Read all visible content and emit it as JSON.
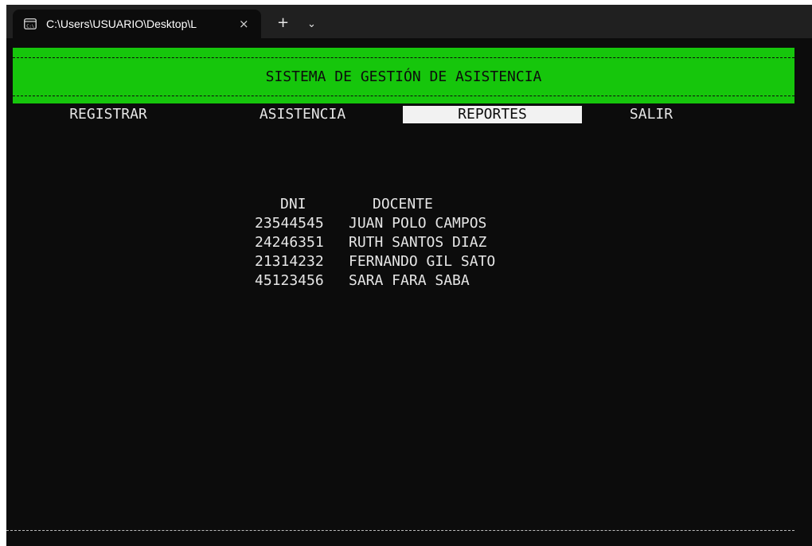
{
  "window": {
    "tab_title": "C:\\Users\\USUARIO\\Desktop\\L",
    "tab_icon": "terminal-icon",
    "close_glyph": "×",
    "new_tab_glyph": "+",
    "dropdown_glyph": "⌄"
  },
  "header": {
    "title": "SISTEMA DE GESTIÓN DE ASISTENCIA",
    "color": "#16c60c"
  },
  "menu": {
    "items": [
      {
        "label": "REGISTRAR"
      },
      {
        "label": "ASISTENCIA"
      },
      {
        "label": "REPORTES",
        "selected": true
      },
      {
        "label": "SALIR"
      }
    ]
  },
  "report": {
    "columns": [
      "DNI",
      "DOCENTE"
    ],
    "rows": [
      {
        "dni": "23544545",
        "docente": "JUAN POLO CAMPOS"
      },
      {
        "dni": "24246351",
        "docente": "RUTH SANTOS DIAZ"
      },
      {
        "dni": "21314232",
        "docente": "FERNANDO GIL SATO"
      },
      {
        "dni": "45123456",
        "docente": "SARA FARA SABA"
      }
    ]
  }
}
